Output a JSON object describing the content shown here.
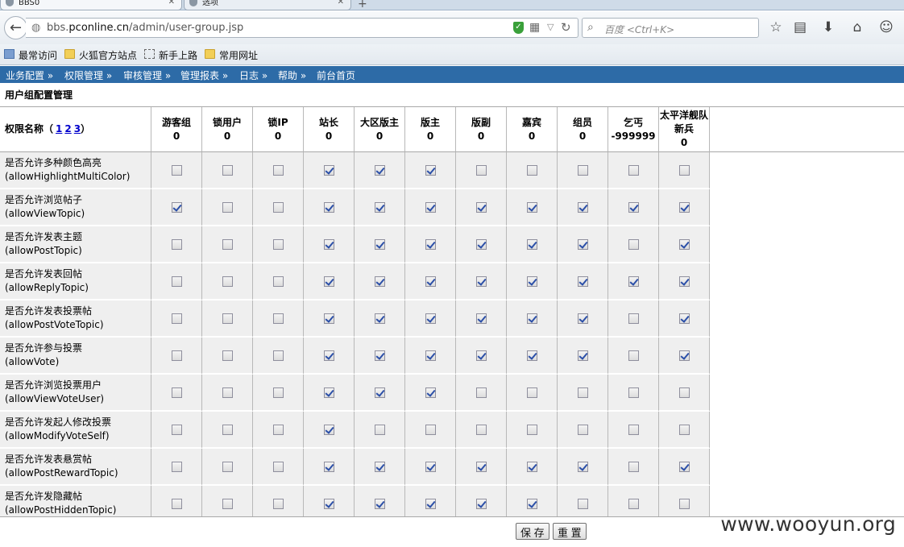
{
  "browser": {
    "tabs": [
      {
        "label": "BBS0",
        "active": true
      },
      {
        "label": "选项",
        "active": false
      }
    ],
    "url_prefix": "bbs.",
    "url_domain": "pconline.cn",
    "url_path": "/admin/user-group.jsp",
    "search_placeholder": "百度 <Ctrl+K>",
    "bookmarks": [
      "最常访问",
      "火狐官方站点",
      "新手上路",
      "常用网址"
    ]
  },
  "admin_menu": [
    "业务配置 »",
    "权限管理 »",
    "审核管理 »",
    "管理报表 »",
    "日志 »",
    "帮助 »",
    "前台首页"
  ],
  "page_title": "用户组配置管理",
  "table": {
    "name_header": "权限名称（",
    "name_header_close": "）",
    "pages": [
      "1",
      "2",
      "3"
    ],
    "groups": [
      {
        "name": "游客组",
        "value": "0"
      },
      {
        "name": "锁用户",
        "value": "0"
      },
      {
        "name": "锁IP",
        "value": "0"
      },
      {
        "name": "站长",
        "value": "0"
      },
      {
        "name": "大区版主",
        "value": "0"
      },
      {
        "name": "版主",
        "value": "0"
      },
      {
        "name": "版副",
        "value": "0"
      },
      {
        "name": "嘉宾",
        "value": "0"
      },
      {
        "name": "组员",
        "value": "0"
      },
      {
        "name": "乞丐",
        "value": "-999999"
      },
      {
        "name": "太平洋舰队新兵",
        "value": "0"
      }
    ],
    "rows": [
      {
        "cn": "是否允许多种颜色高亮",
        "en": "(allowHighlightMultiColor)",
        "checks": [
          0,
          0,
          0,
          1,
          1,
          1,
          0,
          0,
          0,
          0,
          0
        ]
      },
      {
        "cn": "是否允许浏览帖子",
        "en": "(allowViewTopic)",
        "checks": [
          1,
          0,
          0,
          1,
          1,
          1,
          1,
          1,
          1,
          1,
          1
        ]
      },
      {
        "cn": "是否允许发表主题",
        "en": "(allowPostTopic)",
        "checks": [
          0,
          0,
          0,
          1,
          1,
          1,
          1,
          1,
          1,
          0,
          1
        ]
      },
      {
        "cn": "是否允许发表回帖",
        "en": "(allowReplyTopic)",
        "checks": [
          0,
          0,
          0,
          1,
          1,
          1,
          1,
          1,
          1,
          1,
          1
        ]
      },
      {
        "cn": "是否允许发表投票帖",
        "en": "(allowPostVoteTopic)",
        "checks": [
          0,
          0,
          0,
          1,
          1,
          1,
          1,
          1,
          1,
          0,
          1
        ]
      },
      {
        "cn": "是否允许参与投票",
        "en": "(allowVote)",
        "checks": [
          0,
          0,
          0,
          1,
          1,
          1,
          1,
          1,
          1,
          0,
          1
        ]
      },
      {
        "cn": "是否允许浏览投票用户",
        "en": "(allowViewVoteUser)",
        "checks": [
          0,
          0,
          0,
          1,
          1,
          1,
          0,
          0,
          0,
          0,
          0
        ]
      },
      {
        "cn": "是否允许发起人修改投票",
        "en": "(allowModifyVoteSelf)",
        "checks": [
          0,
          0,
          0,
          1,
          0,
          0,
          0,
          0,
          0,
          0,
          0
        ]
      },
      {
        "cn": "是否允许发表悬赏帖",
        "en": "(allowPostRewardTopic)",
        "checks": [
          0,
          0,
          0,
          1,
          1,
          1,
          1,
          1,
          1,
          0,
          1
        ]
      },
      {
        "cn": "是否允许发隐藏帖",
        "en": "(allowPostHiddenTopic)",
        "checks": [
          0,
          0,
          0,
          1,
          1,
          1,
          1,
          1,
          0,
          0,
          0
        ]
      }
    ]
  },
  "buttons": {
    "save": "保 存",
    "reset": "重 置"
  },
  "watermark": "www.wooyun.org"
}
